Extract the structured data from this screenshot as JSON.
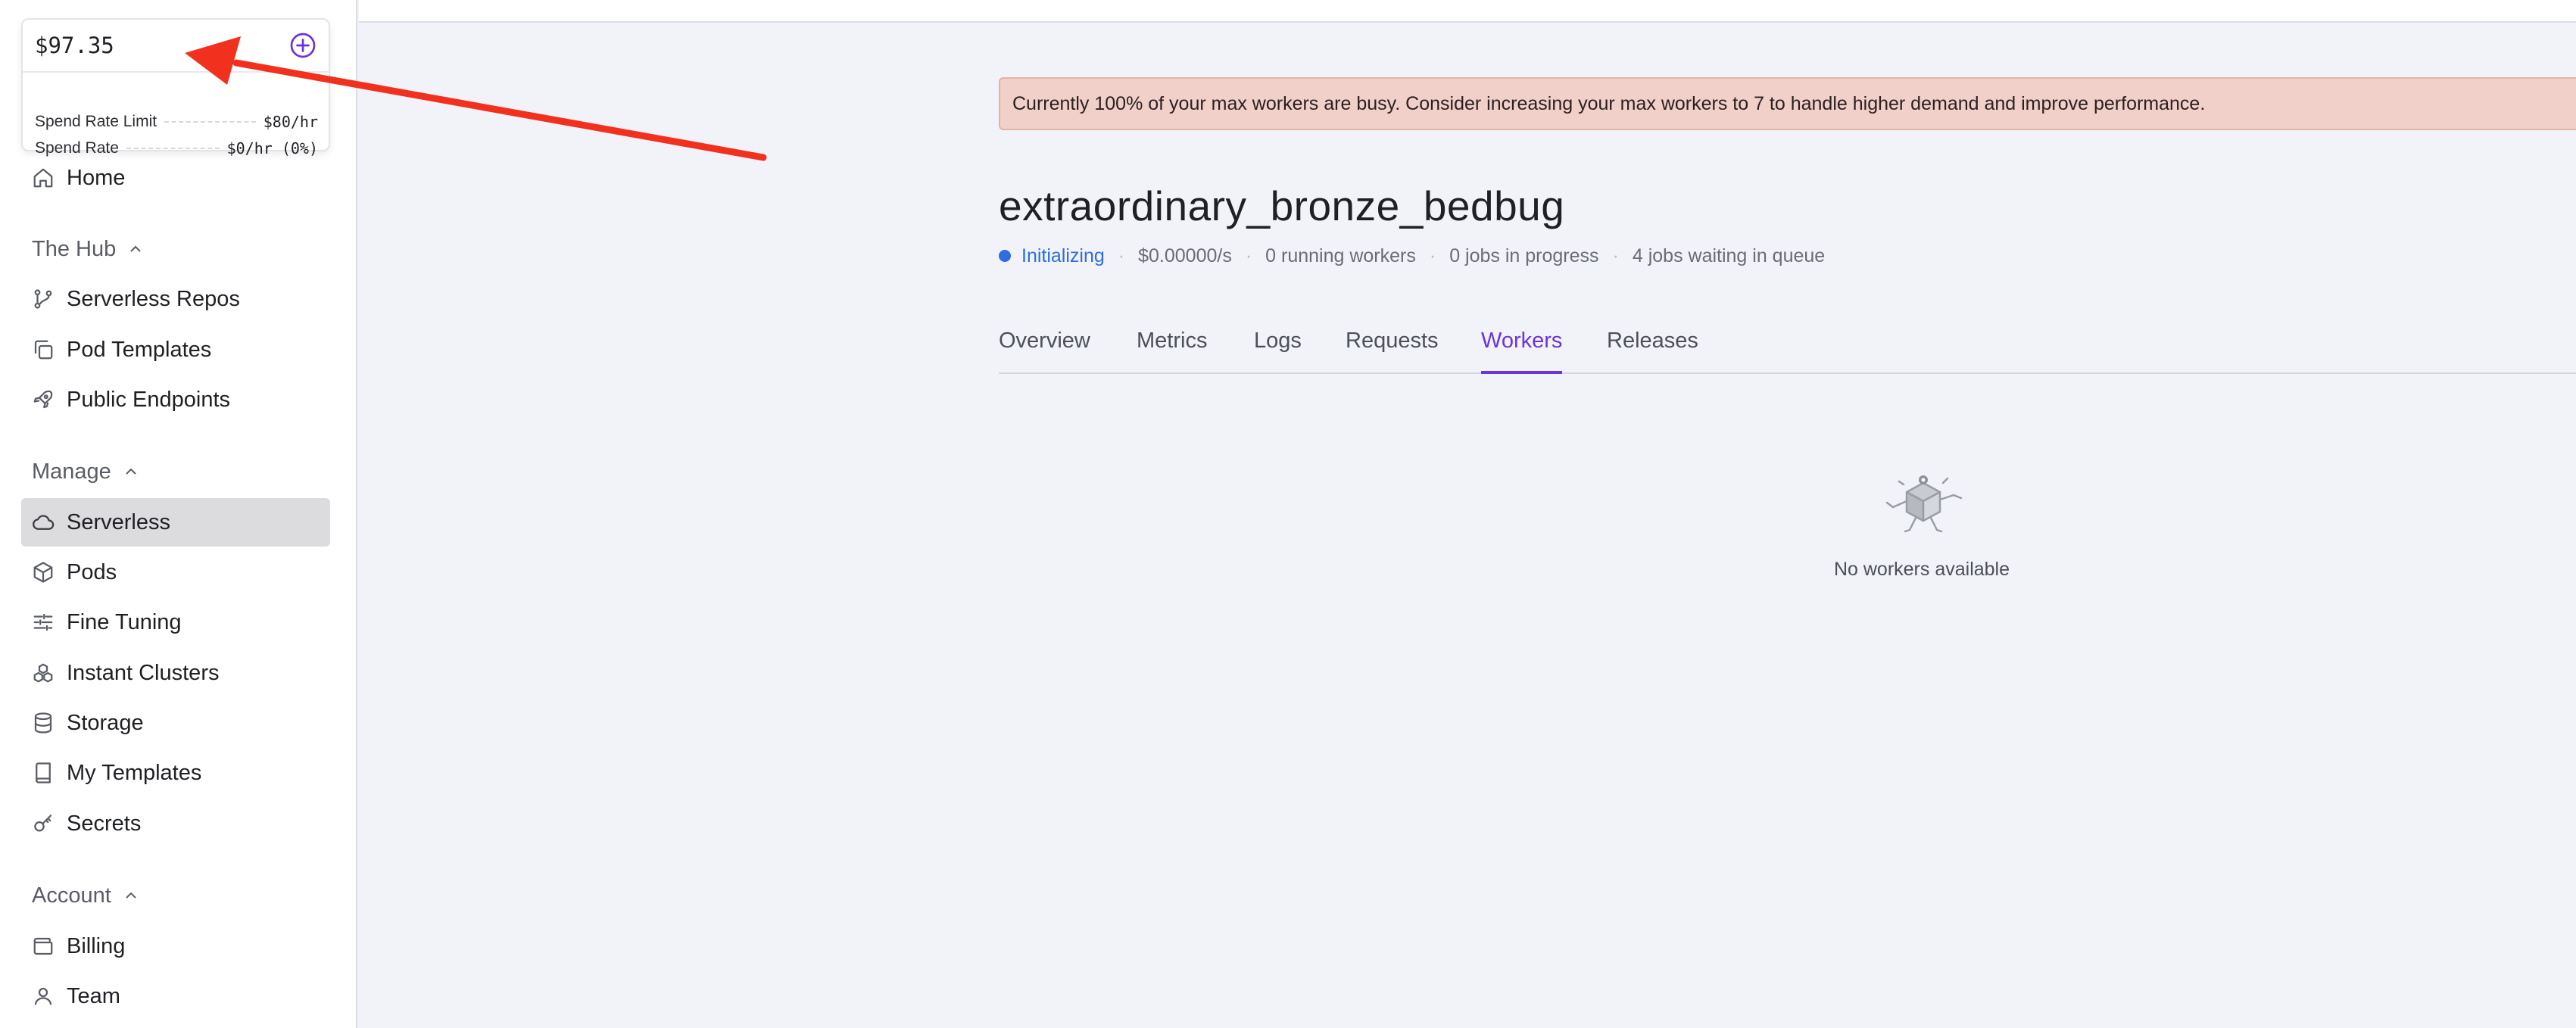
{
  "balance": {
    "value": "$97.35",
    "spend_rate_limit_label": "Spend Rate Limit",
    "spend_rate_limit_value": "$80/hr",
    "spend_rate_label": "Spend Rate",
    "spend_rate_value": "$0/hr (0%)"
  },
  "sidebar": {
    "home": "Home",
    "hub_section": "The Hub",
    "hub_items": [
      "Serverless Repos",
      "Pod Templates",
      "Public Endpoints"
    ],
    "manage_section": "Manage",
    "manage_items": [
      "Serverless",
      "Pods",
      "Fine Tuning",
      "Instant Clusters",
      "Storage",
      "My Templates",
      "Secrets"
    ],
    "account_section": "Account",
    "account_items": [
      "Billing",
      "Team"
    ],
    "active_item": "Serverless"
  },
  "alert": {
    "text": "Currently 100% of your max workers are busy. Consider increasing your max workers to 7 to handle higher demand and improve performance."
  },
  "endpoint": {
    "name": "extraordinary_bronze_bedbug",
    "status": "Initializing",
    "cost": "$0.00000/s",
    "running_workers": "0 running workers",
    "jobs_in_progress": "0 jobs in progress",
    "jobs_in_queue": "4 jobs waiting in queue"
  },
  "tabs": [
    "Overview",
    "Metrics",
    "Logs",
    "Requests",
    "Workers",
    "Releases"
  ],
  "active_tab": "Workers",
  "empty_state": {
    "text": "No workers available"
  },
  "colors": {
    "accent": "#6c34d9",
    "status_blue": "#2f6de0",
    "alert_bg": "#f0d0c8",
    "annotation_arrow": "#f2301e"
  }
}
